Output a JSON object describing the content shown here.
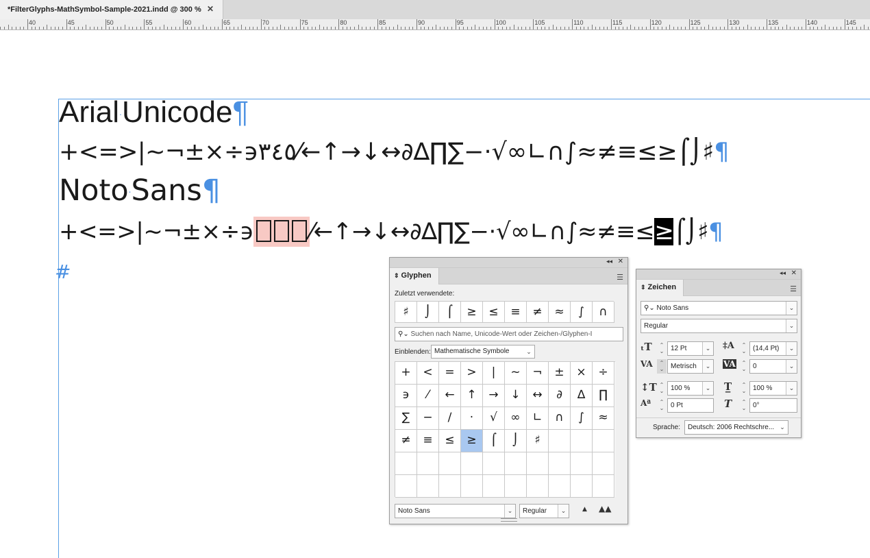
{
  "document_tab": {
    "title": "*FilterGlyphs-MathSymbol-Sample-2021.indd @ 300 %",
    "close": "✕"
  },
  "ruler": {
    "labels": [
      "40",
      "45",
      "50",
      "55",
      "60",
      "65",
      "70",
      "75",
      "80",
      "85",
      "90",
      "95",
      "100",
      "105",
      "110",
      "115",
      "120",
      "125",
      "130",
      "135",
      "140",
      "145"
    ]
  },
  "page": {
    "heading1": "Arial Unicode",
    "heading1_a": "Arial",
    "heading1_b": "Unicode",
    "line1": "+<=>|~¬±×÷϶٣٤٥⁄←↑→↓↔∂∆∏∑−·√∞∟∩∫≈≠≡≤≥⌠⌡♯",
    "heading2_a": "Noto",
    "heading2_b": "Sans",
    "line2_before": "+<=>|~¬±×÷϶",
    "line2_after": "⁄←↑→↓↔∂∆∏∑−·√∞∟∩∫≈≠≡≤",
    "line2_selected": "≥",
    "line2_end": "⌠⌡♯",
    "pilcrow": "¶",
    "space_dot": "·",
    "end_marker": "#"
  },
  "glyphs_panel": {
    "tab": "Glyphen",
    "recent_label": "Zuletzt verwendete:",
    "recent": [
      "♯",
      "⌡",
      "⌠",
      "≥",
      "≤",
      "≡",
      "≠",
      "≈",
      "∫",
      "∩"
    ],
    "search_placeholder": "Suchen nach Name, Unicode-Wert oder Zeichen-/Glyphen-I",
    "show_label": "Einblenden:",
    "show_value": "Mathematische Symbole",
    "grid": [
      [
        "+",
        "<",
        "=",
        ">",
        "|",
        "~",
        "¬",
        "±",
        "×",
        "÷"
      ],
      [
        "϶",
        "⁄",
        "←",
        "↑",
        "→",
        "↓",
        "↔",
        "∂",
        "∆",
        "∏"
      ],
      [
        "∑",
        "−",
        "∕",
        "·",
        "√",
        "∞",
        "∟",
        "∩",
        "∫",
        "≈"
      ],
      [
        "≠",
        "≡",
        "≤",
        "≥",
        "⌠",
        "⌡",
        "♯",
        "",
        "",
        ""
      ],
      [
        "",
        "",
        "",
        "",
        "",
        "",
        "",
        "",
        "",
        ""
      ],
      [
        "",
        "",
        "",
        "",
        "",
        "",
        "",
        "",
        "",
        ""
      ]
    ],
    "selected_glyph": "≥",
    "font": "Noto Sans",
    "style": "Regular"
  },
  "character_panel": {
    "tab": "Zeichen",
    "font": "Noto Sans",
    "style": "Regular",
    "size": "12 Pt",
    "leading": "(14,4 Pt)",
    "kerning": "Metrisch",
    "tracking": "0",
    "vscale": "100 %",
    "hscale": "100 %",
    "baseline": "0 Pt",
    "skew": "0°",
    "language_label": "Sprache:",
    "language": "Deutsch: 2006 Rechtschre..."
  },
  "colors": {
    "accent": "#4a90e2",
    "missing_bg": "#f8c9c4",
    "selection": "#a9c8f0"
  }
}
